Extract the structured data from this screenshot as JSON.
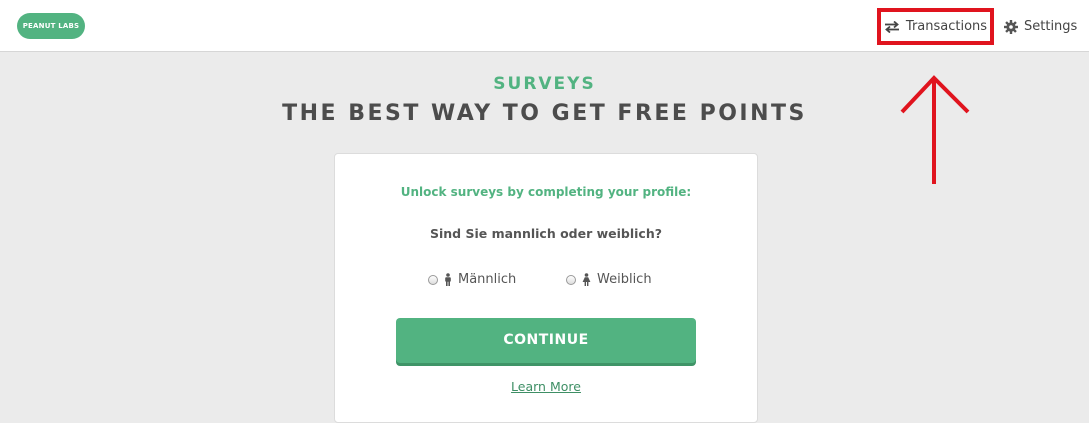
{
  "brand": {
    "logo_text": "PEANUT LABS",
    "accent_color": "#52b381"
  },
  "nav": {
    "transactions_label": "Transactions",
    "transactions_icon": "swap-arrows-icon",
    "settings_label": "Settings",
    "settings_icon": "gear-icon"
  },
  "annotation": {
    "highlight_color": "#e0141e"
  },
  "hero": {
    "section_label": "SURVEYS",
    "headline": "THE BEST WAY TO GET FREE POINTS"
  },
  "card": {
    "intro": "Unlock surveys by completing your profile:",
    "question": "Sind Sie mannlich oder weiblich?",
    "options": [
      {
        "label": "Männlich",
        "icon": "male-icon",
        "selected": false
      },
      {
        "label": "Weiblich",
        "icon": "female-icon",
        "selected": false
      }
    ],
    "continue_label": "CONTINUE",
    "learn_more_label": "Learn More"
  }
}
